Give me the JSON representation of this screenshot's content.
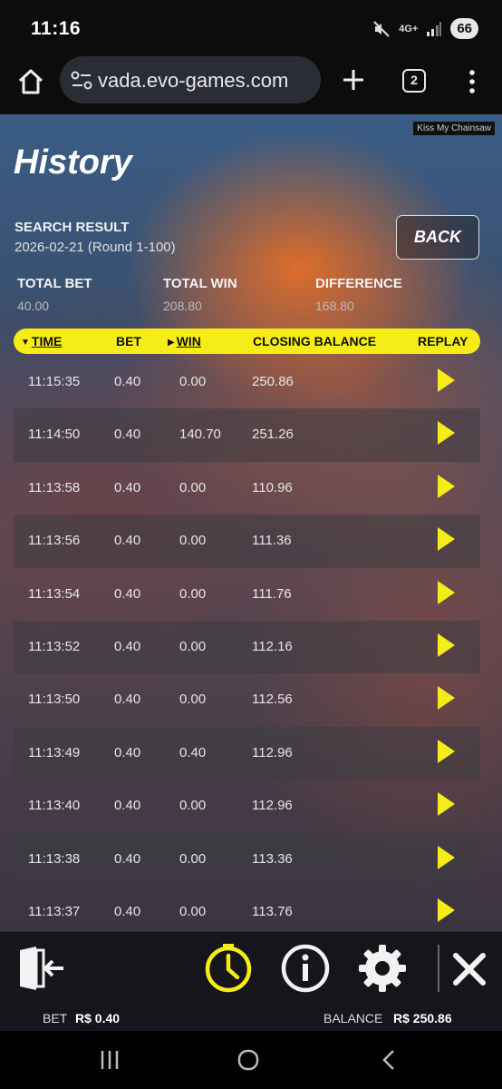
{
  "status": {
    "time": "11:16",
    "network": "4G+",
    "battery": "66"
  },
  "browser": {
    "url": "vada.evo-games.com",
    "tab_count": "2"
  },
  "game": {
    "tag": "Kiss My Chainsaw",
    "title": "History",
    "search_label": "SEARCH RESULT",
    "search_value": "2026-02-21 (Round 1-100)",
    "back_label": "BACK",
    "totals": {
      "bet_label": "TOTAL BET",
      "bet_value": "40.00",
      "win_label": "TOTAL WIN",
      "win_value": "208.80",
      "diff_label": "DIFFERENCE",
      "diff_value": "168.80"
    },
    "columns": {
      "time": "TIME",
      "bet": "BET",
      "win": "WIN",
      "closing": "CLOSING BALANCE",
      "replay": "REPLAY"
    },
    "rows": [
      {
        "time": "11:15:35",
        "bet": "0.40",
        "win": "0.00",
        "closing": "250.86"
      },
      {
        "time": "11:14:50",
        "bet": "0.40",
        "win": "140.70",
        "closing": "251.26"
      },
      {
        "time": "11:13:58",
        "bet": "0.40",
        "win": "0.00",
        "closing": "110.96"
      },
      {
        "time": "11:13:56",
        "bet": "0.40",
        "win": "0.00",
        "closing": "111.36"
      },
      {
        "time": "11:13:54",
        "bet": "0.40",
        "win": "0.00",
        "closing": "111.76"
      },
      {
        "time": "11:13:52",
        "bet": "0.40",
        "win": "0.00",
        "closing": "112.16"
      },
      {
        "time": "11:13:50",
        "bet": "0.40",
        "win": "0.00",
        "closing": "112.56"
      },
      {
        "time": "11:13:49",
        "bet": "0.40",
        "win": "0.40",
        "closing": "112.96"
      },
      {
        "time": "11:13:40",
        "bet": "0.40",
        "win": "0.00",
        "closing": "112.96"
      },
      {
        "time": "11:13:38",
        "bet": "0.40",
        "win": "0.00",
        "closing": "113.36"
      },
      {
        "time": "11:13:37",
        "bet": "0.40",
        "win": "0.00",
        "closing": "113.76"
      }
    ]
  },
  "footer": {
    "bet_label": "BET",
    "bet_value": "R$ 0.40",
    "balance_label": "BALANCE",
    "balance_value": "R$ 250.86"
  },
  "icons": {
    "exit": "exit-icon",
    "history": "history-clock-icon",
    "info": "info-icon",
    "settings": "gear-icon",
    "close": "close-icon",
    "replay": "play-icon"
  },
  "colors": {
    "accent_yellow": "#f6ec17",
    "toolbar_bg": "#15151b"
  }
}
